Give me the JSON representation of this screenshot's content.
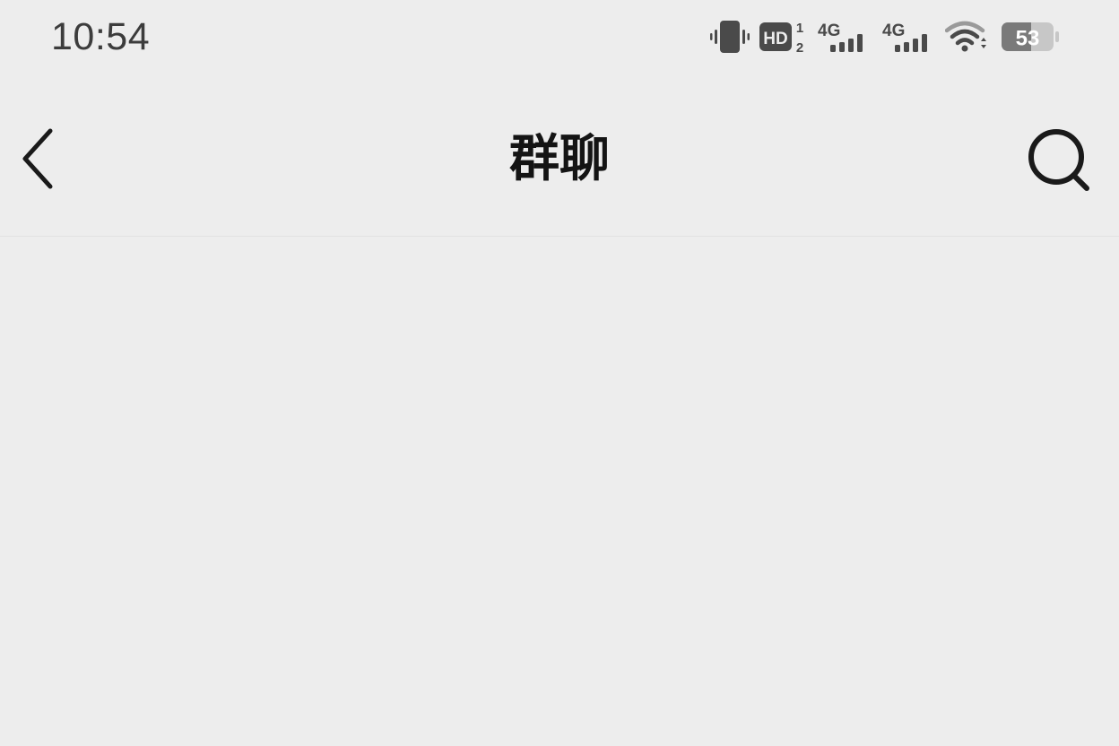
{
  "status_bar": {
    "time": "10:54",
    "hd_label": "HD",
    "hd_sup": "1",
    "hd_sub": "2",
    "network_1": "4G",
    "network_2": "4G",
    "battery_level": "53",
    "icons": [
      "vibrate-icon",
      "hd-call-icon",
      "signal-4g-icon",
      "signal-4g-icon",
      "wifi-icon",
      "battery-icon"
    ]
  },
  "nav": {
    "title": "群聊",
    "back_icon": "chevron-left-icon",
    "search_icon": "search-icon"
  },
  "colors": {
    "background": "#ededed",
    "text": "#141414",
    "status_text": "#3c3c3c"
  }
}
